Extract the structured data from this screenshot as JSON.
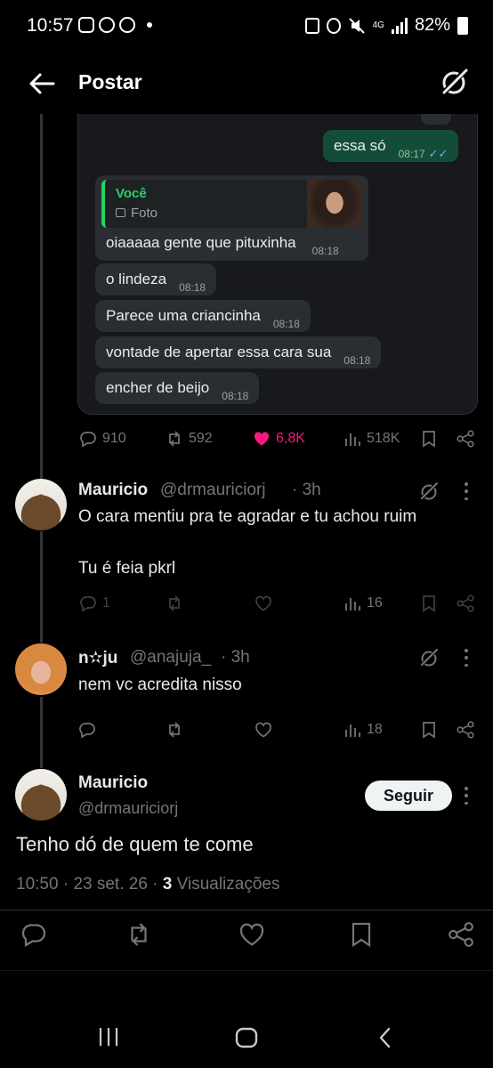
{
  "status_bar": {
    "time": "10:57",
    "network": "4G",
    "battery": "82%"
  },
  "header": {
    "title": "Postar"
  },
  "chat": {
    "outgoing": {
      "text": "essa só",
      "time": "08:17"
    },
    "reply": {
      "quoted_author": "Você",
      "quoted_type": "Foto",
      "text": "oiaaaaa gente que pituxinha",
      "time": "08:18"
    },
    "messages": [
      {
        "text": "o lindeza",
        "time": "08:18"
      },
      {
        "text": "Parece uma criancinha",
        "time": "08:18"
      },
      {
        "text": "vontade de apertar essa cara sua",
        "time": "08:18"
      },
      {
        "text": "encher de beijo",
        "time": "08:18"
      }
    ]
  },
  "main_post_stats": {
    "replies": "910",
    "reposts": "592",
    "likes": "6,8K",
    "views": "518K"
  },
  "replies": [
    {
      "name": "Mauricio",
      "handle": "@drmauriciorj",
      "age": "· 3h",
      "line1": "O cara mentiu pra te agradar e tu achou ruim",
      "line2": "Tu é feia pkrl",
      "replies": "1",
      "views": "16"
    },
    {
      "name": "n✫ju",
      "handle": "@anajuja_",
      "age": "· 3h",
      "line1": "nem vc acredita nisso",
      "views": "18"
    }
  ],
  "focused": {
    "name": "Mauricio",
    "handle": "@drmauriciorj",
    "follow_label": "Seguir",
    "text": "Tenho dó de quem te come",
    "time": "10:50",
    "date": "23 set. 26",
    "views_count": "3",
    "views_label": "Visualizações"
  },
  "colors": {
    "like": "#f91880",
    "wa_green": "#25d366",
    "text_secondary": "#71767b"
  },
  "icons": [
    "back-arrow-icon",
    "grok-icon",
    "reply-icon",
    "repost-icon",
    "heart-icon",
    "views-icon",
    "bookmark-icon",
    "share-icon",
    "more-icon"
  ]
}
